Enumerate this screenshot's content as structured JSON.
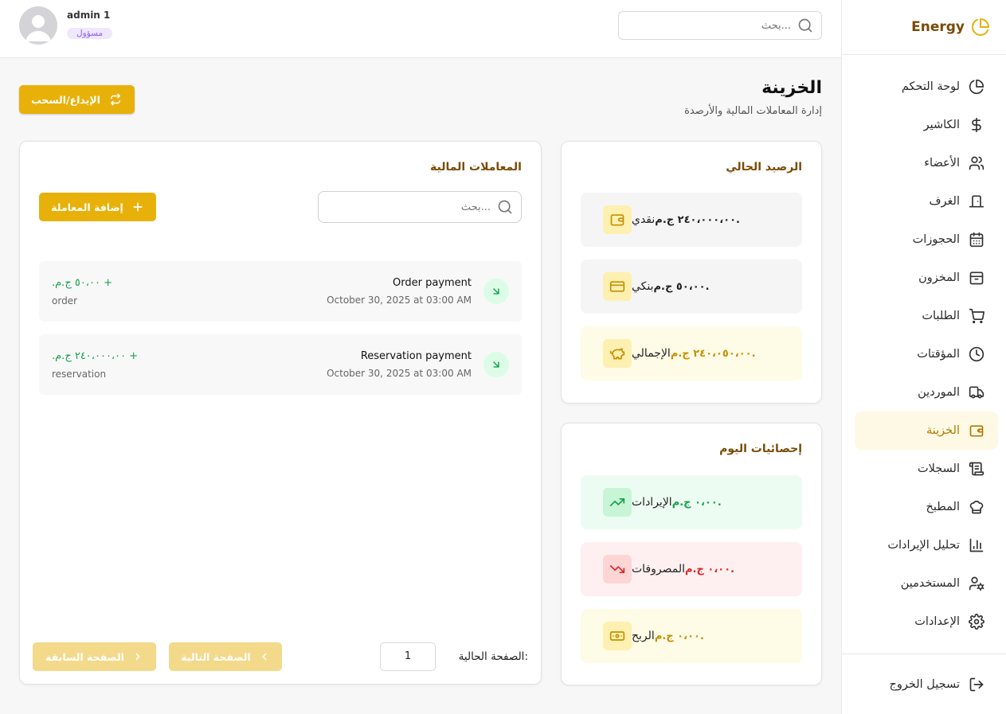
{
  "brand": {
    "name": "Energy"
  },
  "sidebar": {
    "items": [
      {
        "label": "لوحة التحكم",
        "icon": "pie-chart-icon"
      },
      {
        "label": "الكاشير",
        "icon": "dollar-icon"
      },
      {
        "label": "الأعضاء",
        "icon": "users-icon"
      },
      {
        "label": "الغرف",
        "icon": "door-icon"
      },
      {
        "label": "الحجوزات",
        "icon": "calendar-icon"
      },
      {
        "label": "المخزون",
        "icon": "box-icon"
      },
      {
        "label": "الطلبات",
        "icon": "cart-icon"
      },
      {
        "label": "المؤقتات",
        "icon": "clock-icon"
      },
      {
        "label": "الموردين",
        "icon": "truck-icon"
      },
      {
        "label": "الخزينة",
        "icon": "wallet-icon",
        "active": true
      },
      {
        "label": "السجلات",
        "icon": "scroll-icon"
      },
      {
        "label": "المطبخ",
        "icon": "chef-hat-icon"
      },
      {
        "label": "تحليل الإيرادات",
        "icon": "bar-chart-icon"
      },
      {
        "label": "المستخدمين",
        "icon": "user-cog-icon"
      },
      {
        "label": "الإعدادات",
        "icon": "gear-icon"
      }
    ],
    "logout_label": "تسجيل الخروج"
  },
  "topbar": {
    "search_placeholder": "بحث...",
    "user_name": "admin 1",
    "user_role": "مسؤول"
  },
  "page": {
    "title": "الخزينة",
    "subtitle": "إدارة المعاملات المالية والأرصدة",
    "deposit_button": "الإيداع/السحب"
  },
  "balance": {
    "title": "الرصيد الحالي",
    "rows": [
      {
        "label": "نقدي",
        "value": "٢٤٠،٠٠٠،٠٠ ج.م.",
        "icon": "wallet-icon"
      },
      {
        "label": "بنكي",
        "value": "٥٠،٠٠ ج.م.",
        "icon": "credit-card-icon"
      },
      {
        "label": "الإجمالي",
        "value": "٢٤٠،٠٥٠،٠٠ ج.م.",
        "icon": "piggy-bank-icon"
      }
    ]
  },
  "today": {
    "title": "إحصائيات اليوم",
    "rows": [
      {
        "label": "الإيرادات",
        "value": "٠،٠٠ ج.م.",
        "icon": "trending-up-icon"
      },
      {
        "label": "المصروفات",
        "value": "٠،٠٠ ج.م.",
        "icon": "trending-down-icon"
      },
      {
        "label": "الربح",
        "value": "٠،٠٠ ج.م.",
        "icon": "banknote-icon"
      }
    ]
  },
  "transactions": {
    "title": "المعاملات المالية",
    "search_placeholder": "بحث...",
    "add_button": "إضافة المعاملة",
    "items": [
      {
        "title": "Order payment",
        "date": "October 30, 2025 at 03:00 AM",
        "amount": "+ ٥٠،٠٠ ج.م.",
        "type": "order"
      },
      {
        "title": "Reservation payment",
        "date": "October 30, 2025 at 03:00 AM",
        "amount": "+ ٢٤٠،٠٠٠،٠٠ ج.م.",
        "type": "reservation"
      }
    ],
    "pager": {
      "current_label": "الصفحة الحالية:",
      "current_page": "1",
      "next_label": "الصفحة التالية",
      "prev_label": "الصفحة السابقة"
    }
  },
  "colors": {
    "accent": "#e8b10a",
    "brand_text": "#7a4b06",
    "positive": "#16a34a",
    "negative": "#dc2626"
  }
}
